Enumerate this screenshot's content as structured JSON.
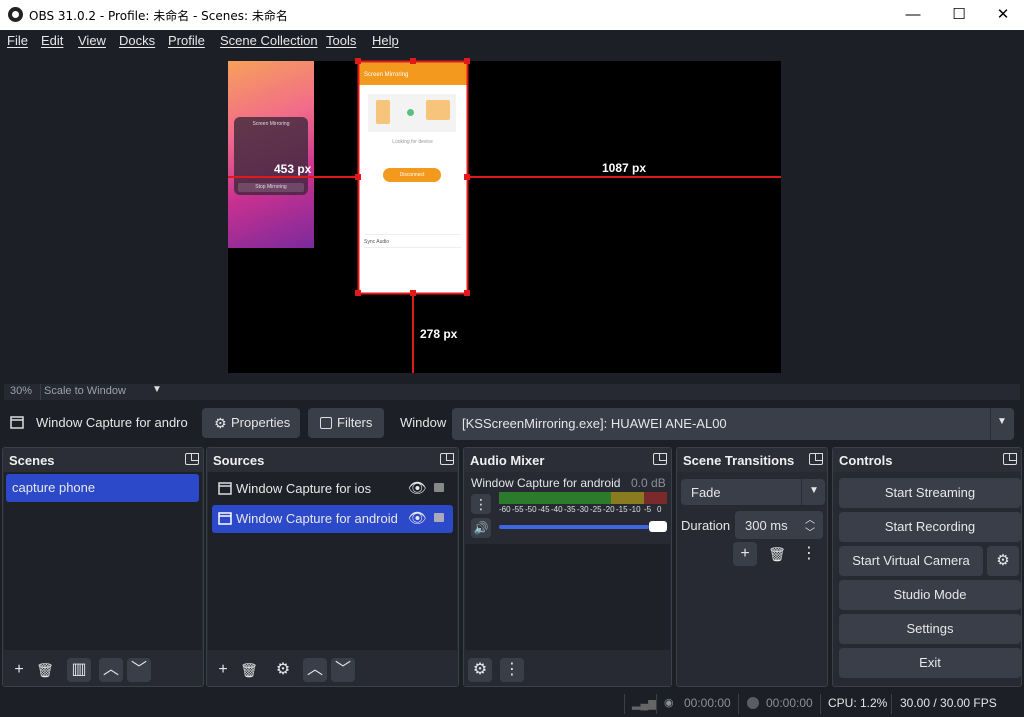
{
  "window": {
    "title": "OBS 31.0.2 - Profile: 未命名 - Scenes: 未命名",
    "minimize": "—",
    "maximize": "☐",
    "close": "✕"
  },
  "menu": [
    "File",
    "Edit",
    "View",
    "Docks",
    "Profile",
    "Scene Collection",
    "Tools",
    "Help"
  ],
  "preview": {
    "measure_right": "1087 px",
    "measure_bottom": "278 px",
    "measure_left": "453 px",
    "zoom": "30%",
    "scale_mode": "Scale to Window",
    "phone_app_title": "Screen Mirroring",
    "phone_status": "Looking for device",
    "phone_button": "Disconnect",
    "phone_audio": "Sync Audio",
    "ios_title": "Screen Mirroring",
    "ios_stop": "Stop Mirroring"
  },
  "source_toolbar": {
    "source_name": "Window Capture for andro",
    "properties": "Properties",
    "filters": "Filters",
    "window_label": "Window",
    "window_value": "[KSScreenMirroring.exe]: HUAWEI  ANE-AL00"
  },
  "docks": {
    "scenes": {
      "title": "Scenes",
      "items": [
        "capture phone"
      ]
    },
    "sources": {
      "title": "Sources",
      "items": [
        "Window Capture for ios",
        "Window Capture for android"
      ]
    },
    "audio": {
      "title": "Audio Mixer",
      "channel_name": "Window Capture for android",
      "channel_db": "0.0 dB",
      "meter_ticks": [
        "-60",
        "-55",
        "-50",
        "-45",
        "-40",
        "-35",
        "-30",
        "-25",
        "-20",
        "-15",
        "-10",
        "-5",
        "0"
      ],
      "volume": 1.0
    },
    "transitions": {
      "title": "Scene Transitions",
      "transition": "Fade",
      "duration_label": "Duration",
      "duration_value": "300 ms"
    },
    "controls": {
      "title": "Controls",
      "start_streaming": "Start Streaming",
      "start_recording": "Start Recording",
      "start_virtual_camera": "Start Virtual Camera",
      "studio_mode": "Studio Mode",
      "settings": "Settings",
      "exit": "Exit"
    }
  },
  "status": {
    "stream_time": "00:00:00",
    "record_time": "00:00:00",
    "cpu": "CPU: 1.2%",
    "fps": "30.00 / 30.00 FPS"
  },
  "colors": {
    "selection": "#2c49c9",
    "accent_orange": "#f39a1e",
    "bounding_red": "#e0191a"
  }
}
